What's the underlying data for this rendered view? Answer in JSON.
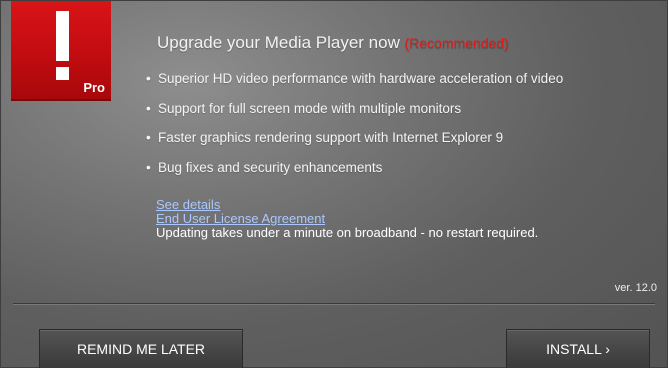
{
  "badge": {
    "icon": "exclamation-icon",
    "label": "Pro",
    "color": "#c80f12"
  },
  "header": {
    "title": "Upgrade your Media Player now",
    "recommended": "(Recommended)",
    "recommended_color": "#e01a1a"
  },
  "features": [
    "Superior HD video performance with hardware acceleration of video",
    "Support for full screen mode with multiple monitors",
    "Faster graphics rendering support with Internet Explorer 9",
    "Bug fixes and security enhancements"
  ],
  "links": {
    "details": "See details",
    "eula": "End User License Agreement",
    "note": "Updating takes under a minute on broadband - no restart required."
  },
  "version": "ver. 12.0",
  "buttons": {
    "remind": "REMIND ME LATER",
    "install": "INSTALL ›"
  }
}
